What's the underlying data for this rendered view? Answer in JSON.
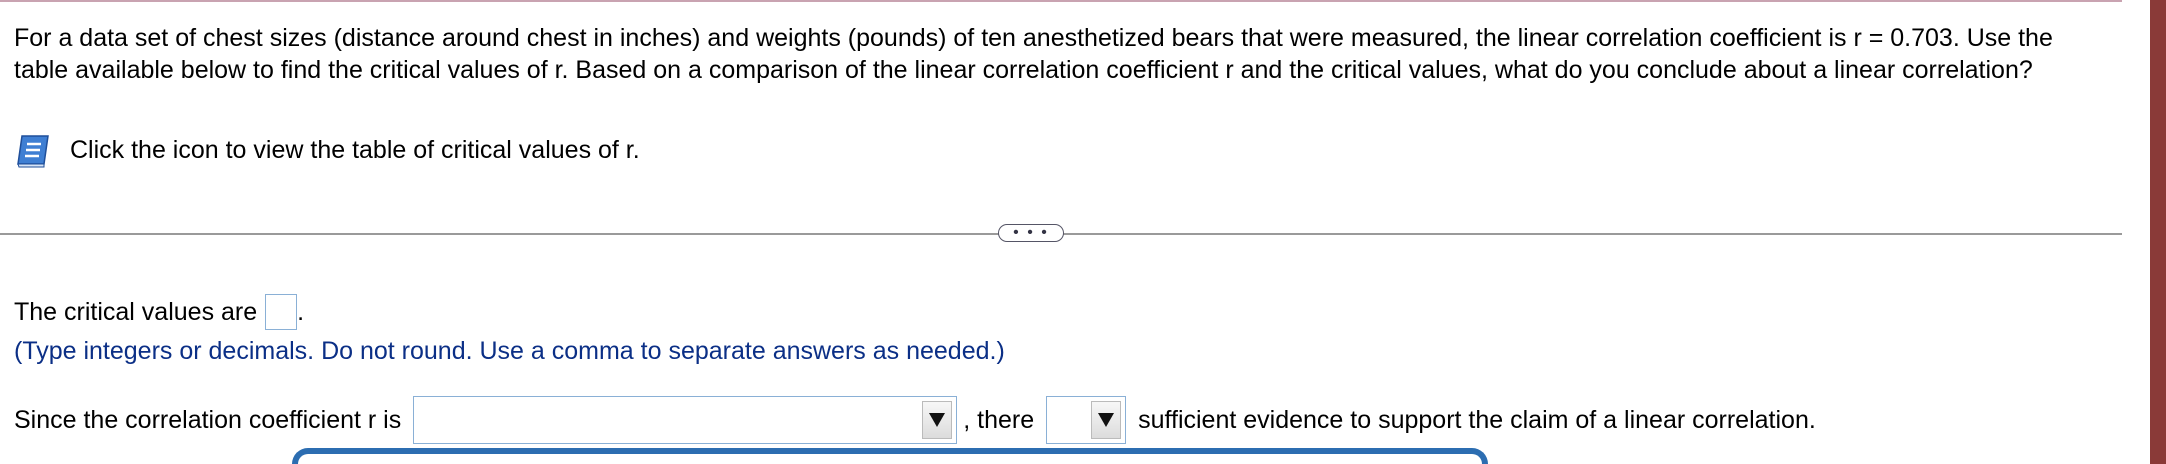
{
  "question": {
    "text": "For a data set of chest sizes (distance around chest in inches) and weights (pounds) of ten anesthetized bears that were measured, the linear correlation coefficient is r = 0.703. Use the table available below to find the critical values of r. Based on a comparison of the linear correlation coefficient r and the critical values, what do you conclude about a linear correlation?"
  },
  "hint": {
    "icon": "book-icon",
    "text": "Click the icon to view the table of critical values of r."
  },
  "divider": {
    "expand_label": "• • •"
  },
  "answer": {
    "critical_values_label": "The critical values are",
    "critical_values_value": "",
    "period": ".",
    "note": "(Type integers or decimals. Do not round. Use a comma to separate answers as needed.)",
    "since_label": "Since the correlation coefficient r is",
    "dropdown1_selected": "",
    "there_label": ", there",
    "dropdown2_selected": "",
    "sufficient_label": "sufficient evidence to support the claim of a linear correlation."
  },
  "colors": {
    "instruction_text": "#0b2f86",
    "input_border": "#8ab0d6",
    "popup_border": "#2c6db1",
    "right_bar": "#8a3a38"
  }
}
